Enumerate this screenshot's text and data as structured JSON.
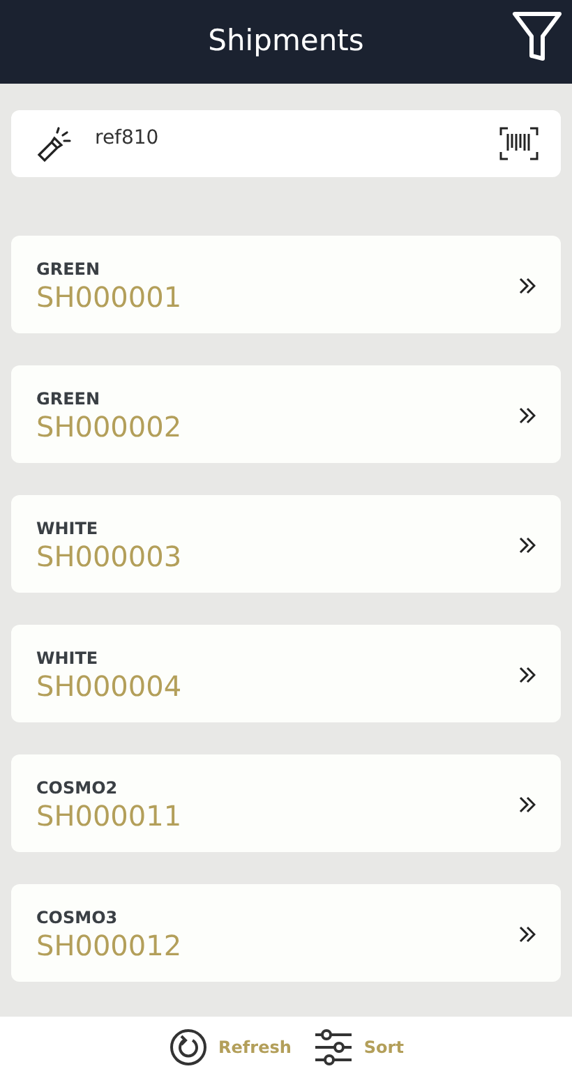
{
  "header": {
    "title": "Shipments"
  },
  "search": {
    "value": "ref810"
  },
  "shipments": [
    {
      "label": "GREEN",
      "code": "SH000001"
    },
    {
      "label": "GREEN",
      "code": "SH000002"
    },
    {
      "label": "WHITE",
      "code": "SH000003"
    },
    {
      "label": "WHITE",
      "code": "SH000004"
    },
    {
      "label": "COSMO2",
      "code": "SH000011"
    },
    {
      "label": "COSMO3",
      "code": "SH000012"
    }
  ],
  "footer": {
    "buttons": [
      {
        "kind": "refresh",
        "label": "Refresh"
      },
      {
        "kind": "sort",
        "label": "Sort"
      }
    ]
  }
}
